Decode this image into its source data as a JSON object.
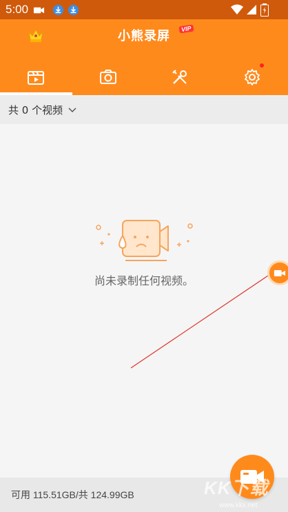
{
  "status_bar": {
    "time": "5:00",
    "icons": [
      "video-camera-icon",
      "download-icon",
      "download-icon",
      "wifi-icon",
      "signal-icon",
      "battery-icon"
    ]
  },
  "header": {
    "title": "小熊录屏",
    "vip_badge": "VIP",
    "crown_icon": "crown-icon",
    "tabs": [
      {
        "name": "videos",
        "icon": "video-clapper-icon",
        "active": true
      },
      {
        "name": "screenshots",
        "icon": "camera-icon",
        "active": false
      },
      {
        "name": "tools",
        "icon": "tools-icon",
        "active": false
      },
      {
        "name": "settings",
        "icon": "gear-icon",
        "active": false,
        "notification_dot": true
      }
    ]
  },
  "filter": {
    "label": "共 0 个视频"
  },
  "empty_state": {
    "message": "尚未录制任何视频。"
  },
  "storage": {
    "text": "可用 115.51GB/共 124.99GB"
  },
  "watermark": {
    "text": "KK下载",
    "url": "www.kkx.net"
  },
  "colors": {
    "primary": "#ff8a1c",
    "status_bar": "#cf5a0c",
    "background": "#f5f5f5"
  }
}
